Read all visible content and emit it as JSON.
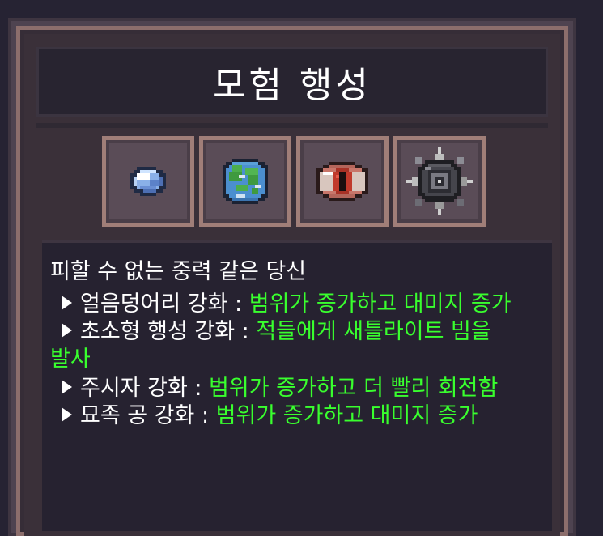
{
  "panel": {
    "title": "모험 행성"
  },
  "slots": [
    {
      "name": "ice-chunk",
      "icon": "ice-chunk-icon"
    },
    {
      "name": "small-planet",
      "icon": "planet-icon"
    },
    {
      "name": "gazer",
      "icon": "eye-icon"
    },
    {
      "name": "gravity-ball",
      "icon": "spiked-orb-icon"
    }
  ],
  "description": {
    "intro": "피할 수 없는 중력 같은 당신",
    "items": [
      {
        "label": "얼음덩어리 강화 : ",
        "effect": "범위가 증가하고 대미지 증가",
        "effect_cont": ""
      },
      {
        "label": "초소형 행성 강화 : ",
        "effect": "적들에게 새틀라이트 빔을",
        "effect_cont": "발사"
      },
      {
        "label": "주시자 강화 : ",
        "effect": "범위가 증가하고 더 빨리 회전함",
        "effect_cont": ""
      },
      {
        "label": "묘족 공 강화 : ",
        "effect": "범위가 증가하고 대미지 증가",
        "effect_cont": ""
      }
    ]
  },
  "colors": {
    "effect_text": "#39ff2e",
    "label_text": "#ffffff",
    "frame_rim": "#a07e78"
  }
}
